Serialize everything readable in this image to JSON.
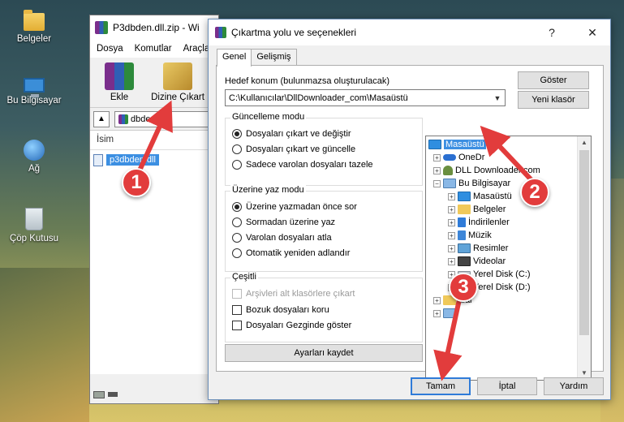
{
  "desktop": {
    "icons": [
      {
        "label": "Belgeler",
        "icon": "folder-icon"
      },
      {
        "label": "Bu Bilgisayar",
        "icon": "computer-icon"
      },
      {
        "label": "Ağ",
        "icon": "network-icon"
      },
      {
        "label": "Çöp Kutusu",
        "icon": "recycle-bin-icon"
      }
    ]
  },
  "winrar": {
    "title": "P3dbden.dll.zip - Wi",
    "menu": [
      "Dosya",
      "Komutlar",
      "Araçla"
    ],
    "toolbar": {
      "add": "Ekle",
      "extract": "Dizine Çıkart"
    },
    "path": "dbden.d",
    "list_header": "İsim",
    "file": "p3dbden.dll"
  },
  "dialog": {
    "title": "Çıkartma yolu ve seçenekleri",
    "tabs": [
      "Genel",
      "Gelişmiş"
    ],
    "dest_label": "Hedef konum (bulunmazsa oluşturulacak)",
    "dest_value": "C:\\Kullanıcılar\\DllDownloader_com\\Masaüstü",
    "show_button": "Göster",
    "new_folder_button": "Yeni klasör",
    "update_mode": {
      "title": "Güncelleme modu",
      "options": [
        "Dosyaları çıkart ve değiştir",
        "Dosyaları çıkart ve güncelle",
        "Sadece varolan dosyaları tazele"
      ],
      "selected": 0
    },
    "overwrite_mode": {
      "title": "Üzerine yaz modu",
      "options": [
        "Üzerine yazmadan önce sor",
        "Sormadan üzerine yaz",
        "Varolan dosyaları atla",
        "Otomatik yeniden adlandır"
      ],
      "selected": 0
    },
    "misc": {
      "title": "Çeşitli",
      "options": [
        "Arşivleri alt klasörlere çıkart",
        "Bozuk dosyaları koru",
        "Dosyaları Gezginde göster"
      ]
    },
    "save_settings": "Ayarları kaydet",
    "tree": [
      {
        "label": "Masaüstü",
        "icon": "desktop-icon",
        "selected": true
      },
      {
        "label": "OneDr",
        "icon": "onedrive-icon"
      },
      {
        "label": "DLL Downloader.com",
        "icon": "user-icon"
      },
      {
        "label": "Bu Bilgisayar",
        "icon": "computer-icon"
      },
      {
        "label": "Masaüstü",
        "icon": "desktop-icon"
      },
      {
        "label": "Belgeler",
        "icon": "folder-icon"
      },
      {
        "label": "İndirilenler",
        "icon": "download-icon"
      },
      {
        "label": "Müzik",
        "icon": "music-icon"
      },
      {
        "label": "Resimler",
        "icon": "pictures-icon"
      },
      {
        "label": "Videolar",
        "icon": "video-icon"
      },
      {
        "label": "Yerel Disk (C:)",
        "icon": "disk-icon"
      },
      {
        "label": "Yerel Disk (D:)",
        "icon": "disk-icon"
      },
      {
        "label": "klar",
        "icon": "folder-icon"
      }
    ],
    "buttons": {
      "ok": "Tamam",
      "cancel": "İptal",
      "help": "Yardım"
    }
  },
  "markers": [
    "1",
    "2",
    "3"
  ],
  "colors": {
    "selection": "#3c8fe2",
    "marker": "#e23c3c"
  }
}
